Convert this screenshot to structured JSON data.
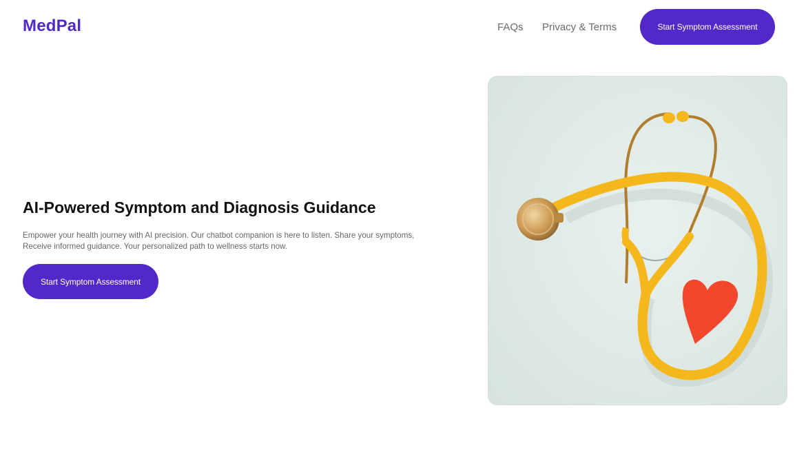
{
  "header": {
    "logo": "MedPal",
    "nav": {
      "faqs": "FAQs",
      "privacy": "Privacy & Terms"
    },
    "cta_label": "Start Symptom Assessment"
  },
  "hero": {
    "title": "AI-Powered Symptom and Diagnosis Guidance",
    "description_line1": "Empower your health journey with AI precision. Our chatbot companion is here to listen. Share your symptoms,",
    "description_line2": "Receive informed guidance. Your personalized path to wellness starts now.",
    "cta_label": "Start Symptom Assessment",
    "image": "stethoscope-with-heart-photo"
  },
  "colors": {
    "brand": "#5228c8",
    "text_dark": "#111111",
    "text_muted": "#666666",
    "image_bg": "#dfe9e6",
    "tube": "#f5b81c",
    "heart": "#f2462d"
  }
}
